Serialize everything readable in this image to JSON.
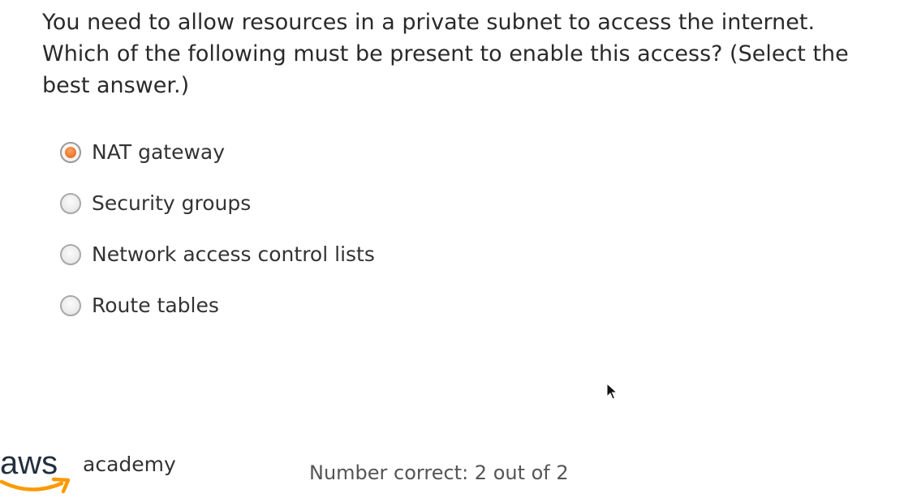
{
  "question": {
    "text": "You need to allow resources in a private subnet to access the internet. Which of the following must be present to enable this access? (Select the best answer.)"
  },
  "options": [
    {
      "label": "NAT gateway",
      "selected": true
    },
    {
      "label": "Security groups",
      "selected": false
    },
    {
      "label": "Network access control lists",
      "selected": false
    },
    {
      "label": "Route tables",
      "selected": false
    }
  ],
  "logo": {
    "brand": "aws",
    "product": "academy"
  },
  "score": {
    "text": "Number correct: 2 out of 2"
  },
  "colors": {
    "selected_accent": "#ef7a2c",
    "aws_navy": "#232f3e",
    "aws_orange": "#ff9900"
  },
  "icons": {
    "cursor": "mouse-pointer-icon",
    "logo_smile": "aws-smile-arrow-icon"
  }
}
